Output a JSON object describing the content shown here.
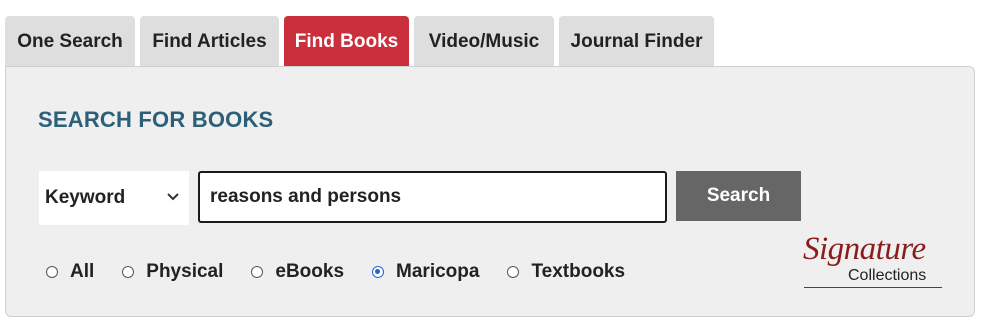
{
  "tabs": [
    {
      "label": "One Search",
      "active": false
    },
    {
      "label": "Find Articles",
      "active": false
    },
    {
      "label": "Find Books",
      "active": true
    },
    {
      "label": "Video/Music",
      "active": false
    },
    {
      "label": "Journal Finder",
      "active": false
    }
  ],
  "panel": {
    "heading": "SEARCH FOR BOOKS"
  },
  "search": {
    "field_select": "Keyword",
    "query": "reasons and persons",
    "button_label": "Search"
  },
  "filters": [
    {
      "label": "All",
      "checked": false
    },
    {
      "label": "Physical",
      "checked": false
    },
    {
      "label": "eBooks",
      "checked": false
    },
    {
      "label": "Maricopa",
      "checked": true
    },
    {
      "label": "Textbooks",
      "checked": false
    }
  ],
  "logo": {
    "line1": "Signature",
    "line2": "Collections"
  },
  "colors": {
    "active_tab": "#c9303c",
    "heading": "#2c5f78",
    "button": "#666666",
    "logo_red": "#8b1c1c"
  },
  "icons": {
    "select_chevron": "chevron-down-icon"
  }
}
